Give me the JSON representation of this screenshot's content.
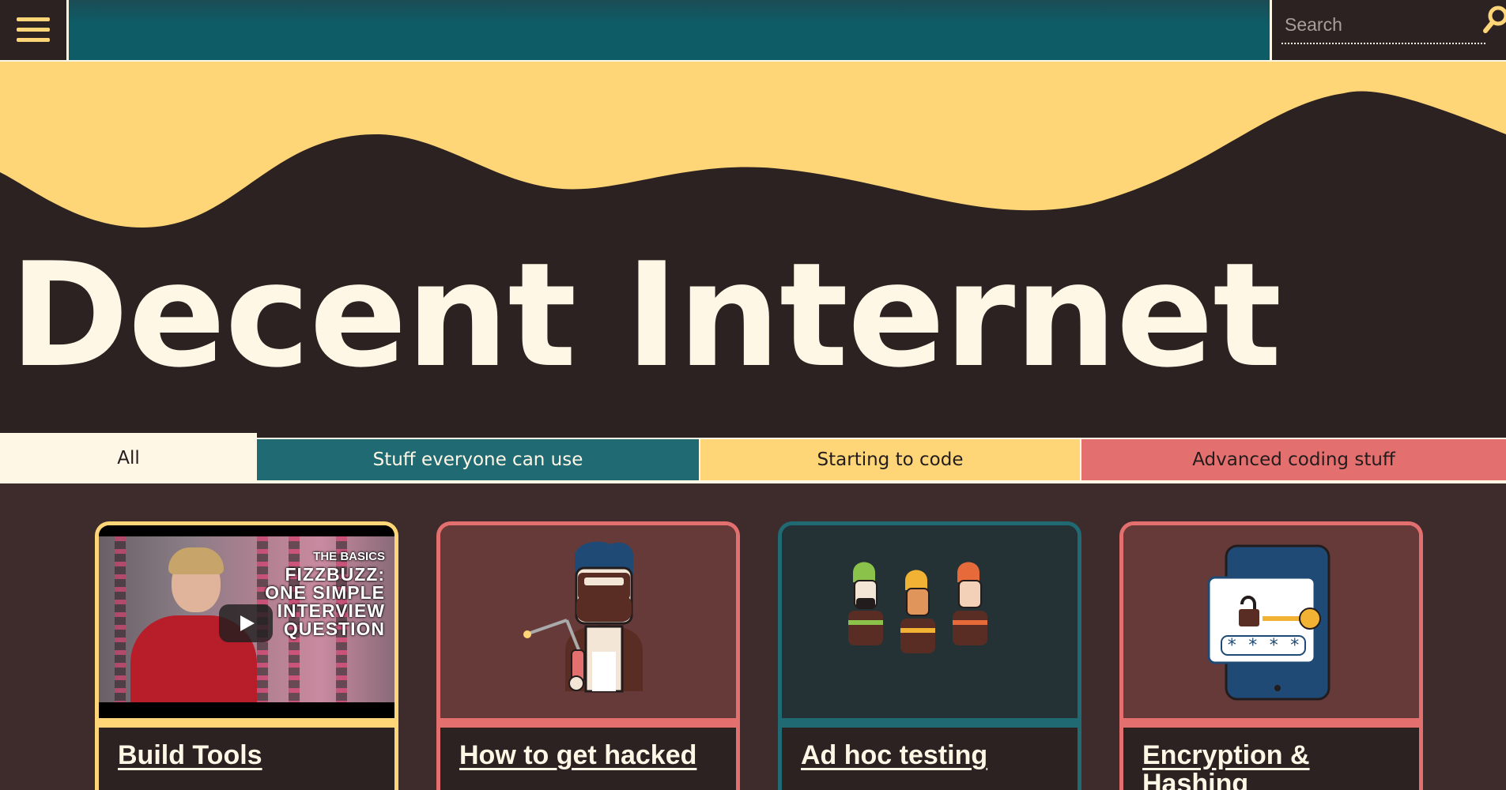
{
  "header": {
    "search_placeholder": "Search"
  },
  "hero": {
    "title": "Decent Internet"
  },
  "tabs": [
    {
      "label": "All"
    },
    {
      "label": "Stuff everyone can use"
    },
    {
      "label": "Starting to code"
    },
    {
      "label": "Advanced coding stuff"
    }
  ],
  "cards": [
    {
      "title": "Build Tools",
      "video": {
        "small_text": "THE BASICS",
        "lines": [
          "FIZZBUZZ:",
          "ONE SIMPLE",
          "INTERVIEW",
          "QUESTION"
        ]
      }
    },
    {
      "title": "How to get hacked"
    },
    {
      "title": "Ad hoc testing"
    },
    {
      "title": "Encryption & Hashing"
    }
  ],
  "colors": {
    "dark": "#2c2222",
    "cream": "#fff7e6",
    "yellow": "#ffd677",
    "teal": "#1f6a73",
    "coral": "#e46f6f"
  },
  "icons": {
    "menu": "hamburger-icon",
    "search": "search-icon",
    "play": "play-icon"
  }
}
